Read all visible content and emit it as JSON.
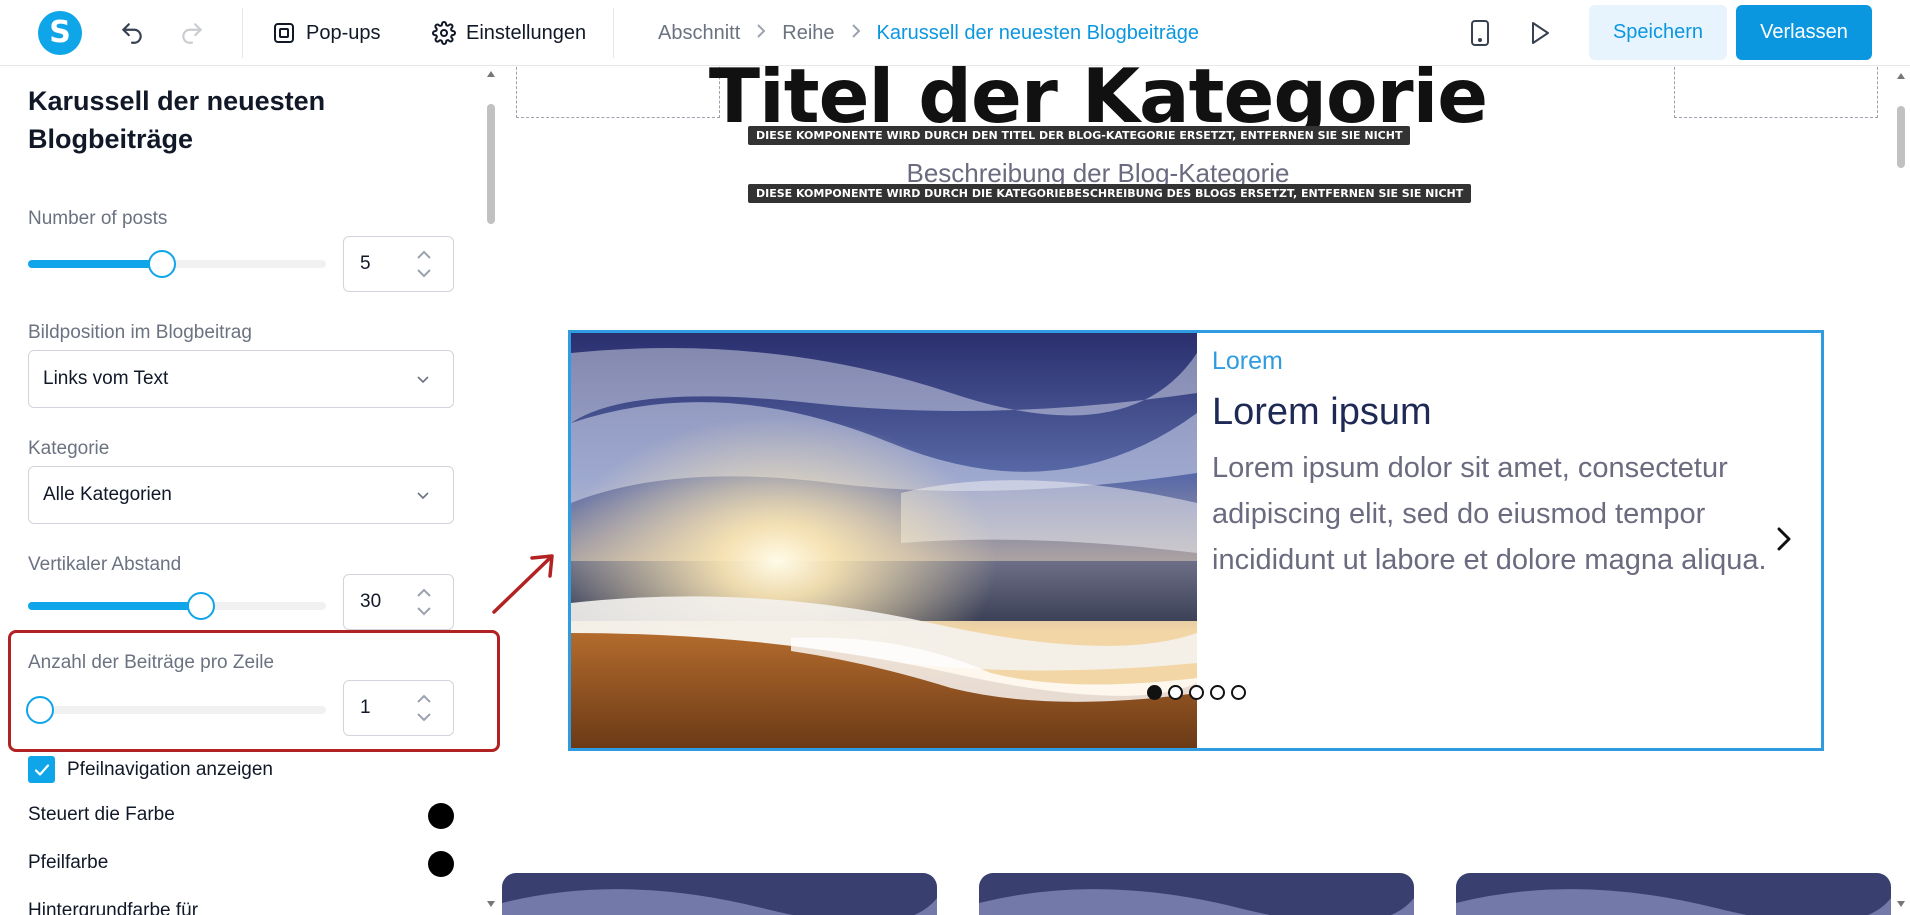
{
  "toolbar": {
    "logo_letter": "S",
    "popups_label": "Pop-ups",
    "settings_label": "Einstellungen",
    "save_label": "Speichern",
    "exit_label": "Verlassen"
  },
  "breadcrumb": {
    "items": [
      "Abschnitt",
      "Reihe",
      "Karussell der neuesten Blogbeiträge"
    ]
  },
  "sidebar": {
    "title": "Karussell der neuesten Blogbeiträge",
    "number_of_posts": {
      "label": "Number of posts",
      "value": "5",
      "slider_fraction": 0.45
    },
    "image_position": {
      "label": "Bildposition im Blogbeitrag",
      "value": "Links vom Text"
    },
    "category": {
      "label": "Kategorie",
      "value": "Alle Kategorien"
    },
    "vertical_spacing": {
      "label": "Vertikaler Abstand",
      "value": "30",
      "slider_fraction": 0.58
    },
    "posts_per_row": {
      "label": "Anzahl der Beiträge pro Zeile",
      "value": "1",
      "slider_fraction": 0.04
    },
    "arrow_nav": {
      "label": "Pfeilnavigation anzeigen",
      "checked": true
    },
    "control_color": {
      "label": "Steuert die Farbe",
      "color": "#000000"
    },
    "arrow_color": {
      "label": "Pfeilfarbe",
      "color": "#000000"
    },
    "bg_color": {
      "label": "Hintergrundfarbe für"
    }
  },
  "canvas": {
    "category_title": "Titel der Kategorie",
    "title_notice": "DIESE KOMPONENTE WIRD DURCH DEN TITEL DER BLOG-KATEGORIE ERSETZT, ENTFERNEN SIE SIE NICHT",
    "category_description": "Beschreibung der Blog-Kategorie",
    "description_notice": "DIESE KOMPONENTE WIRD DURCH DIE KATEGORIEBESCHREIBUNG DES BLOGS ERSETZT, ENTFERNEN SIE SIE NICHT",
    "post": {
      "category": "Lorem",
      "title": "Lorem ipsum",
      "excerpt": "Lorem ipsum dolor sit amet, consectetur adipiscing elit, sed do eiusmod tempor incididunt ut labore et dolore magna aliqua."
    },
    "pagination": {
      "count": 5,
      "active_index": 0
    }
  },
  "colors": {
    "accent": "#0b97e0",
    "highlight": "#b22222"
  }
}
